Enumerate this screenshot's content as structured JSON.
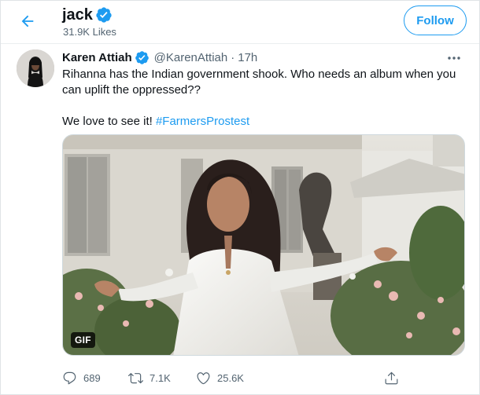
{
  "header": {
    "name": "jack",
    "subtitle": "31.9K Likes",
    "follow_label": "Follow",
    "back_icon": "arrow-left-icon",
    "verified_icon": "verified-badge-icon"
  },
  "tweet": {
    "author_name": "Karen Attiah",
    "author_handle": "@KarenAttiah",
    "separator": "·",
    "time": "17h",
    "text_line_1": "Rihanna has the Indian government shook. Who needs an album when you can uplift the oppressed??",
    "text_line_2_prefix": "We love to see it! ",
    "hashtag": "#FarmersProstest",
    "media_badge": "GIF",
    "more_icon": "more-horizontal-icon"
  },
  "actions": {
    "reply_count": "689",
    "retweet_count": "7.1K",
    "like_count": "25.6K",
    "reply_icon": "reply-icon",
    "retweet_icon": "retweet-icon",
    "like_icon": "heart-icon",
    "share_icon": "share-icon"
  },
  "colors": {
    "accent": "#1d9bf0",
    "text": "#0f1419",
    "secondary_text": "#536471"
  }
}
